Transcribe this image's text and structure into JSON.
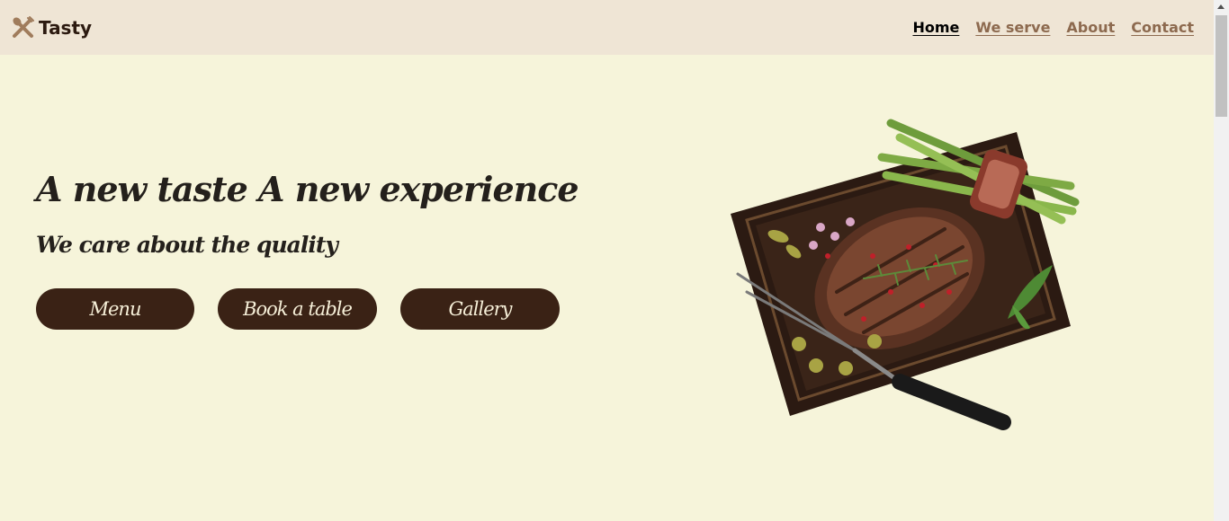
{
  "navbar": {
    "brand": "Tasty",
    "brand_icon": "utensils-icon",
    "links": [
      {
        "label": "Home",
        "active": true
      },
      {
        "label": "We serve",
        "active": false
      },
      {
        "label": "About",
        "active": false
      },
      {
        "label": "Contact",
        "active": false
      }
    ]
  },
  "hero": {
    "title": "A new taste A new experience",
    "subtitle": "We care about the quality",
    "buttons": {
      "menu": "Menu",
      "book": "Book a table",
      "gallery": "Gallery"
    },
    "image_icon": "steak-board-image"
  },
  "colors": {
    "background": "#f6f4da",
    "navbar": "#efe5d5",
    "button": "#3a2215",
    "link": "#8d6a4f"
  }
}
